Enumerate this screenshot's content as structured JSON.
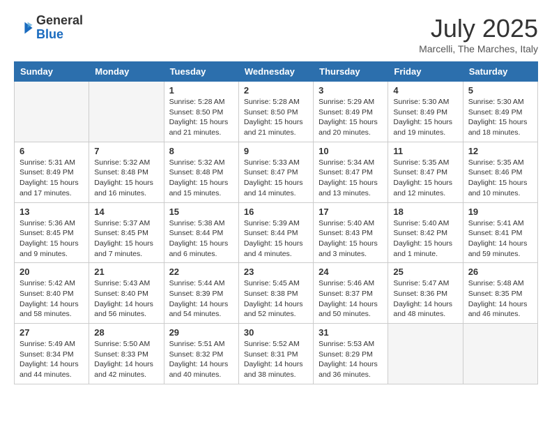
{
  "header": {
    "logo_line1": "General",
    "logo_line2": "Blue",
    "month_title": "July 2025",
    "location": "Marcelli, The Marches, Italy"
  },
  "weekdays": [
    "Sunday",
    "Monday",
    "Tuesday",
    "Wednesday",
    "Thursday",
    "Friday",
    "Saturday"
  ],
  "weeks": [
    [
      {
        "day": null
      },
      {
        "day": null
      },
      {
        "day": "1",
        "sunrise": "5:28 AM",
        "sunset": "8:50 PM",
        "daylight": "15 hours and 21 minutes."
      },
      {
        "day": "2",
        "sunrise": "5:28 AM",
        "sunset": "8:50 PM",
        "daylight": "15 hours and 21 minutes."
      },
      {
        "day": "3",
        "sunrise": "5:29 AM",
        "sunset": "8:49 PM",
        "daylight": "15 hours and 20 minutes."
      },
      {
        "day": "4",
        "sunrise": "5:30 AM",
        "sunset": "8:49 PM",
        "daylight": "15 hours and 19 minutes."
      },
      {
        "day": "5",
        "sunrise": "5:30 AM",
        "sunset": "8:49 PM",
        "daylight": "15 hours and 18 minutes."
      }
    ],
    [
      {
        "day": "6",
        "sunrise": "5:31 AM",
        "sunset": "8:49 PM",
        "daylight": "15 hours and 17 minutes."
      },
      {
        "day": "7",
        "sunrise": "5:32 AM",
        "sunset": "8:48 PM",
        "daylight": "15 hours and 16 minutes."
      },
      {
        "day": "8",
        "sunrise": "5:32 AM",
        "sunset": "8:48 PM",
        "daylight": "15 hours and 15 minutes."
      },
      {
        "day": "9",
        "sunrise": "5:33 AM",
        "sunset": "8:47 PM",
        "daylight": "15 hours and 14 minutes."
      },
      {
        "day": "10",
        "sunrise": "5:34 AM",
        "sunset": "8:47 PM",
        "daylight": "15 hours and 13 minutes."
      },
      {
        "day": "11",
        "sunrise": "5:35 AM",
        "sunset": "8:47 PM",
        "daylight": "15 hours and 12 minutes."
      },
      {
        "day": "12",
        "sunrise": "5:35 AM",
        "sunset": "8:46 PM",
        "daylight": "15 hours and 10 minutes."
      }
    ],
    [
      {
        "day": "13",
        "sunrise": "5:36 AM",
        "sunset": "8:45 PM",
        "daylight": "15 hours and 9 minutes."
      },
      {
        "day": "14",
        "sunrise": "5:37 AM",
        "sunset": "8:45 PM",
        "daylight": "15 hours and 7 minutes."
      },
      {
        "day": "15",
        "sunrise": "5:38 AM",
        "sunset": "8:44 PM",
        "daylight": "15 hours and 6 minutes."
      },
      {
        "day": "16",
        "sunrise": "5:39 AM",
        "sunset": "8:44 PM",
        "daylight": "15 hours and 4 minutes."
      },
      {
        "day": "17",
        "sunrise": "5:40 AM",
        "sunset": "8:43 PM",
        "daylight": "15 hours and 3 minutes."
      },
      {
        "day": "18",
        "sunrise": "5:40 AM",
        "sunset": "8:42 PM",
        "daylight": "15 hours and 1 minute."
      },
      {
        "day": "19",
        "sunrise": "5:41 AM",
        "sunset": "8:41 PM",
        "daylight": "14 hours and 59 minutes."
      }
    ],
    [
      {
        "day": "20",
        "sunrise": "5:42 AM",
        "sunset": "8:40 PM",
        "daylight": "14 hours and 58 minutes."
      },
      {
        "day": "21",
        "sunrise": "5:43 AM",
        "sunset": "8:40 PM",
        "daylight": "14 hours and 56 minutes."
      },
      {
        "day": "22",
        "sunrise": "5:44 AM",
        "sunset": "8:39 PM",
        "daylight": "14 hours and 54 minutes."
      },
      {
        "day": "23",
        "sunrise": "5:45 AM",
        "sunset": "8:38 PM",
        "daylight": "14 hours and 52 minutes."
      },
      {
        "day": "24",
        "sunrise": "5:46 AM",
        "sunset": "8:37 PM",
        "daylight": "14 hours and 50 minutes."
      },
      {
        "day": "25",
        "sunrise": "5:47 AM",
        "sunset": "8:36 PM",
        "daylight": "14 hours and 48 minutes."
      },
      {
        "day": "26",
        "sunrise": "5:48 AM",
        "sunset": "8:35 PM",
        "daylight": "14 hours and 46 minutes."
      }
    ],
    [
      {
        "day": "27",
        "sunrise": "5:49 AM",
        "sunset": "8:34 PM",
        "daylight": "14 hours and 44 minutes."
      },
      {
        "day": "28",
        "sunrise": "5:50 AM",
        "sunset": "8:33 PM",
        "daylight": "14 hours and 42 minutes."
      },
      {
        "day": "29",
        "sunrise": "5:51 AM",
        "sunset": "8:32 PM",
        "daylight": "14 hours and 40 minutes."
      },
      {
        "day": "30",
        "sunrise": "5:52 AM",
        "sunset": "8:31 PM",
        "daylight": "14 hours and 38 minutes."
      },
      {
        "day": "31",
        "sunrise": "5:53 AM",
        "sunset": "8:29 PM",
        "daylight": "14 hours and 36 minutes."
      },
      {
        "day": null
      },
      {
        "day": null
      }
    ]
  ]
}
